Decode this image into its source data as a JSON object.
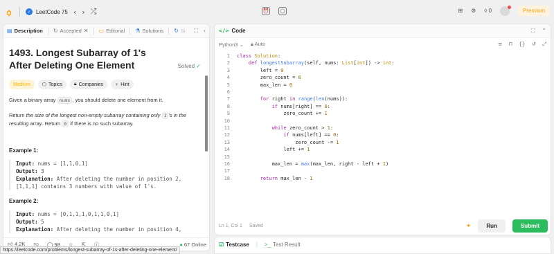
{
  "topbar": {
    "list_title": "LeetCode 75",
    "counter": "0",
    "premium": "Premium"
  },
  "left_tabs": [
    {
      "label": "Description",
      "active": true
    },
    {
      "label": "Accepted",
      "active": false
    },
    {
      "label": "Editorial",
      "active": false
    },
    {
      "label": "Solutions",
      "active": false
    },
    {
      "label": "Si",
      "active": false
    }
  ],
  "problem": {
    "title": "1493. Longest Subarray of 1's After Deleting One Element",
    "status": "Solved",
    "difficulty": "Medium",
    "tags": [
      "Topics",
      "Companies",
      "Hint"
    ],
    "p1_pre": "Given a binary array ",
    "p1_code": "nums",
    "p1_post": ", you should delete one element from it.",
    "p2_pre": "Return ",
    "p2_italic": "the size of the longest non-empty subarray containing only ",
    "p2_code1": "1",
    "p2_italic2": "'s in the resulting array",
    "p2_mid": ". Return ",
    "p2_code2": "0",
    "p2_post": " if there is no such subarray.",
    "examples": [
      {
        "heading": "Example 1:",
        "input_label": "Input:",
        "input": "nums = [1,1,0,1]",
        "output_label": "Output:",
        "output": "3",
        "expl_label": "Explanation:",
        "expl_line1": "After deleting the number in position 2,",
        "expl_line2": "[1,1,1] contains 3 numbers with value of 1's."
      },
      {
        "heading": "Example 2:",
        "input_label": "Input:",
        "input": "nums = [0,1,1,1,0,1,1,0,1]",
        "output_label": "Output:",
        "output": "5",
        "expl_label": "Explanation:",
        "expl_line1": "After deleting the number in position 4,"
      }
    ]
  },
  "left_footer": {
    "likes": "4.2K",
    "comments": "98",
    "online": "67 Online"
  },
  "status_url": "https://leetcode.com/problems/longest-subarray-of-1s-after-deleting-one-element/",
  "code_panel": {
    "title": "Code",
    "language": "Python3",
    "mode": "Auto",
    "cursor": "Ln 1, Col 1",
    "saved": "Saved",
    "run": "Run",
    "submit": "Submit"
  },
  "code_lines": [
    "class Solution:",
    "    def longestSubarray(self, nums: List[int]) -> int:",
    "        left = 0",
    "        zero_count = 0",
    "        max_len = 0",
    "",
    "        for right in range(len(nums)):",
    "            if nums[right] == 0:",
    "                zero_count += 1",
    "",
    "            while zero_count > 1:",
    "                if nums[left] == 0:",
    "                    zero_count -= 1",
    "                left += 1",
    "",
    "            max_len = max(max_len, right - left + 1)",
    "",
    "        return max_len - 1"
  ],
  "bottom_tabs": {
    "testcase": "Testcase",
    "result": "Test Result"
  }
}
